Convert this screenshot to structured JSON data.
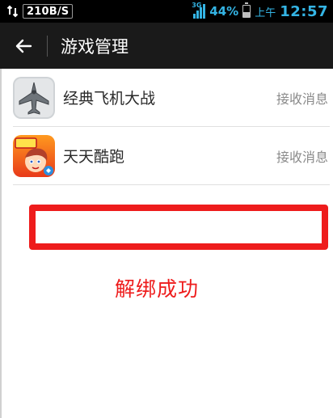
{
  "status_bar": {
    "network_speed": "210B/S",
    "network_type": "3G",
    "battery_percent": "44%",
    "battery_level": 0.44,
    "ampm": "上午",
    "time": "12:57"
  },
  "app_bar": {
    "title": "游戏管理",
    "back_icon": "arrow-left-icon"
  },
  "games": [
    {
      "name": "经典飞机大战",
      "action": "接收消息",
      "icon": "plane-game-icon"
    },
    {
      "name": "天天酷跑",
      "action": "接收消息",
      "icon": "parkour-game-icon"
    }
  ],
  "message": {
    "text": "解绑成功"
  },
  "colors": {
    "status_accent": "#34b4e4",
    "app_bar": "#1a1a1a",
    "highlight": "#ee1c1c"
  }
}
